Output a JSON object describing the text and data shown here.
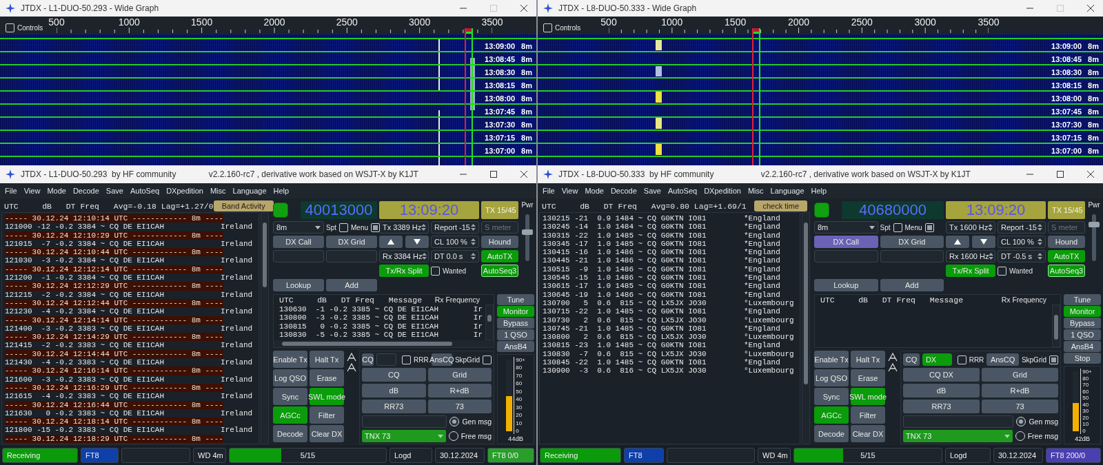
{
  "windows": [
    {
      "wide_graph": {
        "title": "JTDX - L1-DUO-50.293 - Wide Graph",
        "maximize_disabled": true,
        "controls": {
          "label": "Controls",
          "checked": false
        },
        "ruler_labels": [
          "500",
          "1000",
          "1500",
          "2000",
          "2500",
          "3000",
          "3500"
        ],
        "tx_marker": {
          "level": 0.874
        },
        "rows": [
          {
            "time": "13:09:00",
            "band": "8m"
          },
          {
            "time": "13:08:45",
            "band": "8m"
          },
          {
            "time": "13:08:30",
            "band": "8m"
          },
          {
            "time": "13:08:15",
            "band": "8m"
          },
          {
            "time": "13:08:00",
            "band": "8m"
          },
          {
            "time": "13:07:45",
            "band": "8m"
          },
          {
            "time": "13:07:30",
            "band": "8m"
          },
          {
            "time": "13:07:15",
            "band": "8m"
          },
          {
            "time": "13:07:00",
            "band": "8m"
          }
        ]
      },
      "main": {
        "title": "JTDX - L1-DUO-50.293  by HF community",
        "version": "v2.2.160-rc7 , derivative work based on WSJT-X by K1JT",
        "menu": [
          "File",
          "View",
          "Mode",
          "Decode",
          "Save",
          "AutoSeq",
          "DXpedition",
          "Misc",
          "Language",
          "Help"
        ],
        "band_activity": {
          "header": "UTC     dB   DT Freq   Avg=-0.18 Lag=+1.27/0",
          "button": "Band Activity",
          "lines": [
            {
              "kind": "separator",
              "text": "----- 30.12.24 12:10:14 UTC ------------ 8m ----"
            },
            {
              "kind": "decode",
              "text": "121000 -12 -0.2 3384 ~ CQ DE EI1CAH",
              "country": "Ireland"
            },
            {
              "kind": "separator",
              "text": "----- 30.12.24 12:10:29 UTC ------------ 8m ----"
            },
            {
              "kind": "decode",
              "text": "121015  -7 -0.2 3384 ~ CQ DE EI1CAH",
              "country": "Ireland"
            },
            {
              "kind": "separator",
              "text": "----- 30.12.24 12:10:44 UTC ------------ 8m ----"
            },
            {
              "kind": "decode",
              "text": "121030  -3 -0.2 3384 ~ CQ DE EI1CAH",
              "country": "Ireland"
            },
            {
              "kind": "separator",
              "text": "----- 30.12.24 12:12:14 UTC ------------ 8m ----"
            },
            {
              "kind": "decode",
              "text": "121200  -1 -0.2 3384 ~ CQ DE EI1CAH",
              "country": "Ireland"
            },
            {
              "kind": "separator",
              "text": "----- 30.12.24 12:12:29 UTC ------------ 8m ----"
            },
            {
              "kind": "decode",
              "text": "121215  -2 -0.2 3384 ~ CQ DE EI1CAH",
              "country": "Ireland"
            },
            {
              "kind": "separator",
              "text": "----- 30.12.24 12:12:44 UTC ------------ 8m ----"
            },
            {
              "kind": "decode",
              "text": "121230  -4 -0.2 3384 ~ CQ DE EI1CAH",
              "country": "Ireland"
            },
            {
              "kind": "separator",
              "text": "----- 30.12.24 12:14:14 UTC ------------ 8m ----"
            },
            {
              "kind": "decode",
              "text": "121400  -3 -0.2 3383 ~ CQ DE EI1CAH",
              "country": "Ireland"
            },
            {
              "kind": "separator",
              "text": "----- 30.12.24 12:14:29 UTC ------------ 8m ----"
            },
            {
              "kind": "decode",
              "text": "121415  -2 -0.2 3383 ~ CQ DE EI1CAH",
              "country": "Ireland"
            },
            {
              "kind": "separator",
              "text": "----- 30.12.24 12:14:44 UTC ------------ 8m ----"
            },
            {
              "kind": "decode",
              "text": "121430  -4 -0.2 3383 ~ CQ DE EI1CAH",
              "country": "Ireland"
            },
            {
              "kind": "separator",
              "text": "----- 30.12.24 12:16:14 UTC ------------ 8m ----"
            },
            {
              "kind": "decode",
              "text": "121600  -3 -0.2 3383 ~ CQ DE EI1CAH",
              "country": "Ireland"
            },
            {
              "kind": "separator",
              "text": "----- 30.12.24 12:16:29 UTC ------------ 8m ----"
            },
            {
              "kind": "decode",
              "text": "121615  -4 -0.2 3383 ~ CQ DE EI1CAH",
              "country": "Ireland"
            },
            {
              "kind": "separator",
              "text": "----- 30.12.24 12:16:44 UTC ------------ 8m ----"
            },
            {
              "kind": "decode",
              "text": "121630   0 -0.2 3383 ~ CQ DE EI1CAH",
              "country": "Ireland"
            },
            {
              "kind": "separator",
              "text": "----- 30.12.24 12:18:14 UTC ------------ 8m ----"
            },
            {
              "kind": "decode",
              "text": "121800 -15 -0.2 3383 ~ CQ DE EI1CAH",
              "country": "Ireland"
            },
            {
              "kind": "separator",
              "text": "----- 30.12.24 12:18:29 UTC ------------ 8m ----"
            }
          ]
        },
        "monitor_led": {
          "on": true
        },
        "frequency": "40013000",
        "clock": "13:09:20",
        "tx_period": "TX 15/45",
        "pwr": {
          "label": "Pwr",
          "level": 0.62
        },
        "band": "8m",
        "spot": {
          "label": "Spt",
          "checked": false
        },
        "menu_toggle": {
          "label": "Menu",
          "checked": true
        },
        "tx_freq": "Tx 3389 Hz",
        "report": "Report -15",
        "s_meter": {
          "placeholder": "S meter"
        },
        "dx_call": {
          "label": "DX Call",
          "selected": false
        },
        "dx_grid": "DX Grid",
        "cl": "CL 100 %",
        "rx_freq": "Rx 3384 Hz",
        "dt": "DT 0.0 s",
        "hound": {
          "label": "Hound",
          "on": false
        },
        "auto_tx": {
          "label": "AutoTX",
          "on": true
        },
        "split": {
          "label": "Tx/Rx Split",
          "on": true
        },
        "wanted": {
          "label": "Wanted",
          "checked": false
        },
        "autoseq": {
          "label": "AutoSeq3",
          "on": true
        },
        "lookup": "Lookup",
        "add": "Add",
        "rx_pane": {
          "header": "UTC     dB   DT Freq   Message",
          "header_right": "Rx Frequency",
          "horizontal_scrollbar": true,
          "lines": [
            {
              "text": "130630  -1 -0.2 3385 ~ CQ DE EI1CAH",
              "country": "Ir"
            },
            {
              "text": "130800  -3 -0.2 3385 ~ CQ DE EI1CAH",
              "country": "Ir"
            },
            {
              "text": "130815   0 -0.2 3385 ~ CQ DE EI1CAH",
              "country": "Ir"
            },
            {
              "text": "130830  -5 -0.2 3385 ~ CQ DE EI1CAH",
              "country": "Ir"
            }
          ]
        },
        "side_buttons": [
          {
            "label": "Tune",
            "on": false
          },
          {
            "label": "Monitor",
            "on": true
          },
          {
            "label": "Bypass",
            "on": false
          },
          {
            "label": "1 QSO",
            "on": false
          },
          {
            "label": "AnsB4",
            "on": false
          }
        ],
        "actions": [
          {
            "label": "Enable Tx",
            "on": false
          },
          {
            "label": "Halt Tx",
            "on": false
          },
          {
            "label": "Log QSO",
            "on": false
          },
          {
            "label": "Erase",
            "on": false
          },
          {
            "label": "Sync",
            "on": false
          },
          {
            "label": "SWL mode",
            "on": true
          },
          {
            "label": "AGCc",
            "on": true
          },
          {
            "label": "Filter",
            "on": false
          },
          {
            "label": "Decode",
            "on": false
          },
          {
            "label": "Clear DX",
            "on": false
          }
        ],
        "tx_panel": {
          "cq": "CQ",
          "call_field": {
            "highlighted": false
          },
          "rrr": {
            "label": "RRR",
            "checked": false
          },
          "ans_cq": "AnsCQ",
          "skip_grid": {
            "label": "SkpGrid",
            "checked": false
          },
          "messages": [
            "CQ",
            "Grid",
            "dB",
            "R+dB",
            "RR73",
            "73"
          ],
          "gen_msg": {
            "label": "Gen msg",
            "selected": true
          },
          "free_msg": {
            "label": "Free msg",
            "selected": false
          },
          "free_text": "TNX 73"
        },
        "meter": {
          "scale": [
            "90+",
            "80",
            "70",
            "60",
            "50",
            "40",
            "30",
            "20",
            "10",
            "0"
          ],
          "level": 0.49,
          "reading": "44dB"
        },
        "status": [
          {
            "kind": "label",
            "text": "Receiving",
            "color": "#0a9a0a"
          },
          {
            "kind": "label",
            "text": "FT8",
            "color": "#0f3fa8"
          },
          {
            "kind": "blank"
          },
          {
            "kind": "label",
            "text": "WD 4m"
          },
          {
            "kind": "progress",
            "text": "5/15",
            "level": 0.33
          },
          {
            "kind": "label",
            "text": "Logd"
          },
          {
            "kind": "label",
            "text": "30.12.2024"
          },
          {
            "kind": "label",
            "text": "FT8  0/0",
            "color": "#2a9e2a"
          }
        ]
      }
    },
    {
      "wide_graph": {
        "title": "JTDX - L8-DUO-50.333 - Wide Graph",
        "maximize_disabled": true,
        "controls": {
          "label": "Controls",
          "checked": false
        },
        "ruler_labels": [
          "500",
          "1000",
          "1500",
          "2000",
          "2500",
          "3000",
          "3500"
        ],
        "tx_marker": {
          "level": 0.387
        },
        "rows": [
          {
            "time": "13:09:00",
            "band": "8m"
          },
          {
            "time": "13:08:45",
            "band": "8m"
          },
          {
            "time": "13:08:30",
            "band": "8m"
          },
          {
            "time": "13:08:15",
            "band": "8m"
          },
          {
            "time": "13:08:00",
            "band": "8m"
          },
          {
            "time": "13:07:45",
            "band": "8m"
          },
          {
            "time": "13:07:30",
            "band": "8m"
          },
          {
            "time": "13:07:15",
            "band": "8m"
          },
          {
            "time": "13:07:00",
            "band": "8m"
          }
        ]
      },
      "main": {
        "title": "JTDX - L8-DUO-50.333  by HF community",
        "version": "v2.2.160-rc7 , derivative work based on WSJT-X by K1JT",
        "menu": [
          "File",
          "View",
          "Mode",
          "Decode",
          "Save",
          "AutoSeq",
          "DXpedition",
          "Misc",
          "Language",
          "Help"
        ],
        "band_activity": {
          "header": "UTC     dB   DT Freq   Avg=0.80 Lag=+1.69/1",
          "button": "check time",
          "lines": [
            {
              "kind": "decode",
              "text": "130215 -21  0.9 1484 ~ CQ G0KTN IO81",
              "country": "*England"
            },
            {
              "kind": "decode",
              "text": "130245 -14  1.0 1484 ~ CQ G0KTN IO81",
              "country": "*England"
            },
            {
              "kind": "decode",
              "text": "130315 -22  1.0 1485 ~ CQ G0KTN IO81",
              "country": "*England"
            },
            {
              "kind": "decode",
              "text": "130345 -17  1.0 1485 ~ CQ G0KTN IO81",
              "country": "*England"
            },
            {
              "kind": "decode",
              "text": "130415 -16  1.0 1486 ~ CQ G0KTN IO81",
              "country": "*England"
            },
            {
              "kind": "decode",
              "text": "130445 -21  1.0 1486 ~ CQ G0KTN IO81",
              "country": "*England"
            },
            {
              "kind": "decode",
              "text": "130515  -9  1.0 1486 ~ CQ G0KTN IO81",
              "country": "*England"
            },
            {
              "kind": "decode",
              "text": "130545 -15  1.0 1486 ~ CQ G0KTN IO81",
              "country": "*England"
            },
            {
              "kind": "decode",
              "text": "130615 -17  1.0 1485 ~ CQ G0KTN IO81",
              "country": "*England"
            },
            {
              "kind": "decode",
              "text": "130645 -19  1.0 1486 ~ CQ G0KTN IO81",
              "country": "*England"
            },
            {
              "kind": "decode",
              "text": "130700   5  0.6  815 ~ CQ LX5JX JO30",
              "country": "°Luxembourg"
            },
            {
              "kind": "decode",
              "text": "130715 -22  1.0 1485 ~ CQ G0KTN IO81",
              "country": "*England"
            },
            {
              "kind": "decode",
              "text": "130730   2  0.6  815 ~ CQ LX5JX JO30",
              "country": "°Luxembourg"
            },
            {
              "kind": "decode",
              "text": "130745 -21  1.0 1485 ~ CQ G0KTN IO81",
              "country": "*England"
            },
            {
              "kind": "decode",
              "text": "130800   2  0.6  815 ~ CQ LX5JX JO30",
              "country": "°Luxembourg"
            },
            {
              "kind": "decode",
              "text": "130815 -23  1.0 1485 ~ CQ G0KTN IO81",
              "country": "*England"
            },
            {
              "kind": "decode",
              "text": "130830  -7  0.6  815 ~ CQ LX5JX JO30",
              "country": "°Luxembourg"
            },
            {
              "kind": "decode",
              "text": "130845 -22  1.0 1485 ~ CQ G0KTN IO81",
              "country": "*England"
            },
            {
              "kind": "decode",
              "text": "130900  -3  0.6  816 ~ CQ LX5JX JO30",
              "country": "°Luxembourg"
            }
          ]
        },
        "monitor_led": {
          "on": true
        },
        "frequency": "40680000",
        "clock": "13:09:20",
        "tx_period": "TX 15/45",
        "pwr": {
          "label": "Pwr",
          "level": 0.78
        },
        "band": "8m",
        "spot": {
          "label": "Spt",
          "checked": false
        },
        "menu_toggle": {
          "label": "Menu",
          "checked": true
        },
        "tx_freq": "Tx 1600 Hz",
        "report": "Report -15",
        "s_meter": {
          "placeholder": "S meter"
        },
        "dx_call": {
          "label": "DX Call",
          "selected": true
        },
        "dx_grid": "DX Grid",
        "cl": "CL 100 %",
        "rx_freq": "Rx 1600 Hz",
        "dt": "DT -0.5 s",
        "hound": {
          "label": "Hound",
          "on": false
        },
        "auto_tx": {
          "label": "AutoTX",
          "on": true
        },
        "split": {
          "label": "Tx/Rx Split",
          "on": true
        },
        "wanted": {
          "label": "Wanted",
          "checked": false
        },
        "autoseq": {
          "label": "AutoSeq3",
          "on": true
        },
        "lookup": "Lookup",
        "add": "Add",
        "rx_pane": {
          "header": "UTC     dB   DT Freq   Message",
          "header_right": "Rx Frequency",
          "horizontal_scrollbar": false
        },
        "side_buttons": [
          {
            "label": "Tune",
            "on": false
          },
          {
            "label": "Monitor",
            "on": true
          },
          {
            "label": "Bypass",
            "on": false
          },
          {
            "label": "1 QSO",
            "on": false
          },
          {
            "label": "AnsB4",
            "on": false
          },
          {
            "label": "Stop",
            "on": false
          }
        ],
        "actions": [
          {
            "label": "Enable Tx",
            "on": false
          },
          {
            "label": "Halt Tx",
            "on": false
          },
          {
            "label": "Log QSO",
            "on": false
          },
          {
            "label": "Erase",
            "on": false
          },
          {
            "label": "Sync",
            "on": false
          },
          {
            "label": "SWL mode",
            "on": true
          },
          {
            "label": "AGCc",
            "on": true
          },
          {
            "label": "Filter",
            "on": false
          },
          {
            "label": "Decode",
            "on": false
          },
          {
            "label": "Clear DX",
            "on": false
          }
        ],
        "tx_panel": {
          "cq": "CQ",
          "call_field": {
            "value": "DX",
            "highlighted": true
          },
          "rrr": {
            "label": "RRR",
            "checked": false
          },
          "ans_cq": "AnsCQ",
          "skip_grid": {
            "label": "SkpGrid",
            "checked": true
          },
          "messages": [
            "CQ DX",
            "Grid",
            "dB",
            "R+dB",
            "RR73",
            "73"
          ],
          "gen_msg": {
            "label": "Gen msg",
            "selected": true
          },
          "free_msg": {
            "label": "Free msg",
            "selected": false
          },
          "free_text": "TNX 73"
        },
        "meter": {
          "scale": [
            "90+",
            "80",
            "70",
            "60",
            "50",
            "40",
            "30",
            "20",
            "10",
            "0"
          ],
          "level": 0.47,
          "reading": "42dB"
        },
        "status": [
          {
            "kind": "label",
            "text": "Receiving",
            "color": "#0a9a0a"
          },
          {
            "kind": "label",
            "text": "FT8",
            "color": "#0f3fa8"
          },
          {
            "kind": "blank"
          },
          {
            "kind": "label",
            "text": "WD 4m"
          },
          {
            "kind": "progress",
            "text": "5/15",
            "level": 0.33
          },
          {
            "kind": "label",
            "text": "Logd"
          },
          {
            "kind": "label",
            "text": "30.12.2024"
          },
          {
            "kind": "label",
            "text": "FT8  200/0",
            "color": "#4a3fb0"
          }
        ]
      }
    }
  ]
}
